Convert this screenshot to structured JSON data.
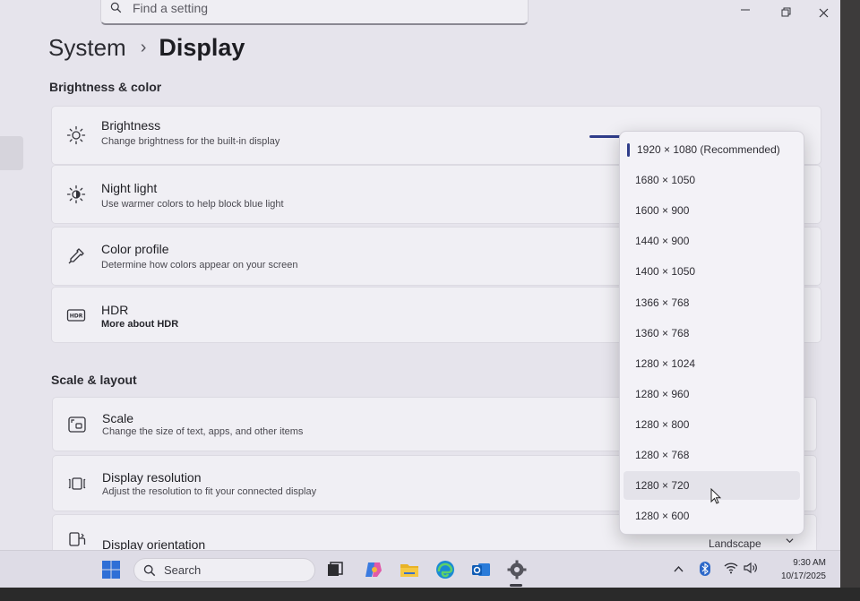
{
  "search": {
    "placeholder": "Find a setting"
  },
  "breadcrumb": {
    "parent": "System",
    "separator": "›",
    "current": "Display"
  },
  "sections": {
    "brightness_color": "Brightness & color",
    "scale_layout": "Scale & layout"
  },
  "settings": {
    "brightness": {
      "title": "Brightness",
      "subtitle": "Change brightness for the built-in display",
      "icon": "sun-icon"
    },
    "night_light": {
      "title": "Night light",
      "subtitle": "Use warmer colors to help block blue light",
      "icon": "sun-moon-icon"
    },
    "color_profile": {
      "title": "Color profile",
      "subtitle": "Determine how colors appear on your screen",
      "icon": "eyedropper-icon"
    },
    "hdr": {
      "title": "HDR",
      "subtitle": "More about HDR",
      "icon": "hdr-icon"
    },
    "scale": {
      "title": "Scale",
      "subtitle": "Change the size of text, apps, and other items",
      "icon": "scale-icon"
    },
    "display_resolution": {
      "title": "Display resolution",
      "subtitle": "Adjust the resolution to fit your connected display",
      "icon": "resolution-icon"
    },
    "display_orientation": {
      "title": "Display orientation",
      "value": "Landscape",
      "icon": "orientation-icon"
    }
  },
  "resolution_dropdown": {
    "options": [
      "1920 × 1080 (Recommended)",
      "1680 × 1050",
      "1600 × 900",
      "1440 × 900",
      "1400 × 1050",
      "1366 × 768",
      "1360 × 768",
      "1280 × 1024",
      "1280 × 960",
      "1280 × 800",
      "1280 × 768",
      "1280 × 720",
      "1280 × 600"
    ],
    "selected_index": 0,
    "hovered_index": 11
  },
  "taskbar": {
    "search_label": "Search",
    "apps": [
      "start-icon",
      "search-icon",
      "task-view-icon",
      "copilot-icon",
      "file-explorer-icon",
      "edge-icon",
      "outlook-icon",
      "settings-icon"
    ],
    "clock": {
      "time": "9:30 AM",
      "date": "10/17/2025"
    }
  },
  "colors": {
    "accent": "#2f3d8a",
    "window_bg": "#e6e4ec",
    "card_bg": "#f0eff4"
  }
}
